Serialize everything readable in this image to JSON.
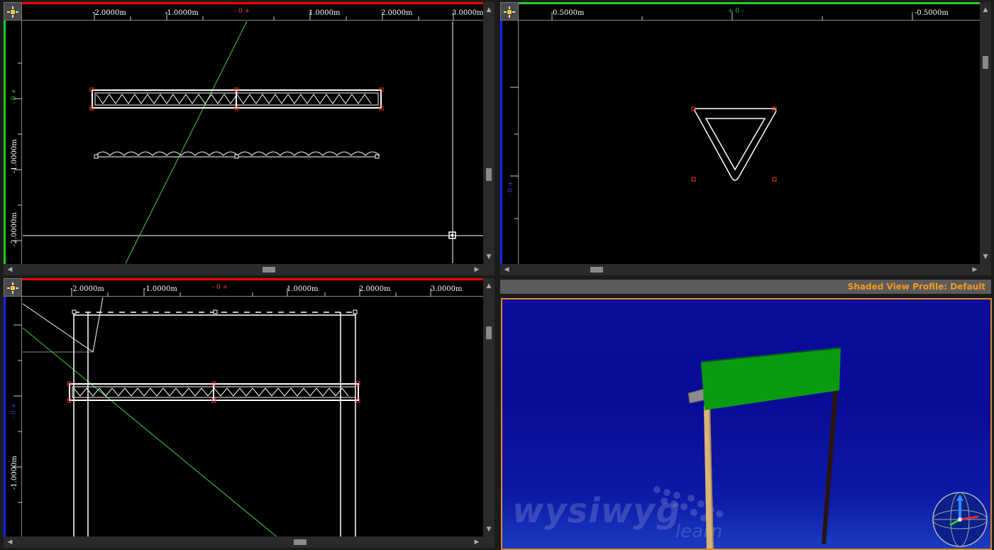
{
  "viewports": {
    "top_left": {
      "h_ruler_labels": [
        "-2.0000m",
        "-1.0000m",
        "- 0 +",
        "1.0000m",
        "2.0000m",
        "3.0000m"
      ],
      "v_ruler_labels": [
        "- 0 +",
        "-1.0000m",
        "-2.0000m"
      ]
    },
    "top_right": {
      "h_ruler_labels": [
        "0.5000m",
        "+ 0 -",
        "-0.5000m"
      ],
      "v_ruler_labels": [
        "- 0 +"
      ]
    },
    "bottom_left": {
      "h_ruler_labels": [
        "-2.0000m",
        "-1.0000m",
        "- 0 +",
        "1.0000m",
        "2.0000m",
        "3.0000m"
      ],
      "v_ruler_labels": [
        "- 0 +",
        "-1.0000m"
      ]
    }
  },
  "shaded_view": {
    "profile_label": "Shaded View Profile: Default",
    "watermark": "wysiwyg",
    "watermark_sub": "learn"
  },
  "icons": {
    "viewport_menu": "crosshair-menu-icon",
    "orientation": "axis-gizmo-icon"
  },
  "colors": {
    "ruler_red": "#ff0000",
    "ruler_green": "#22cc22",
    "ruler_blue": "#1a22ff",
    "profile_text": "#f29a1c",
    "shaded_bg": "#0b0c9a",
    "sign_green": "#0a9a12"
  }
}
